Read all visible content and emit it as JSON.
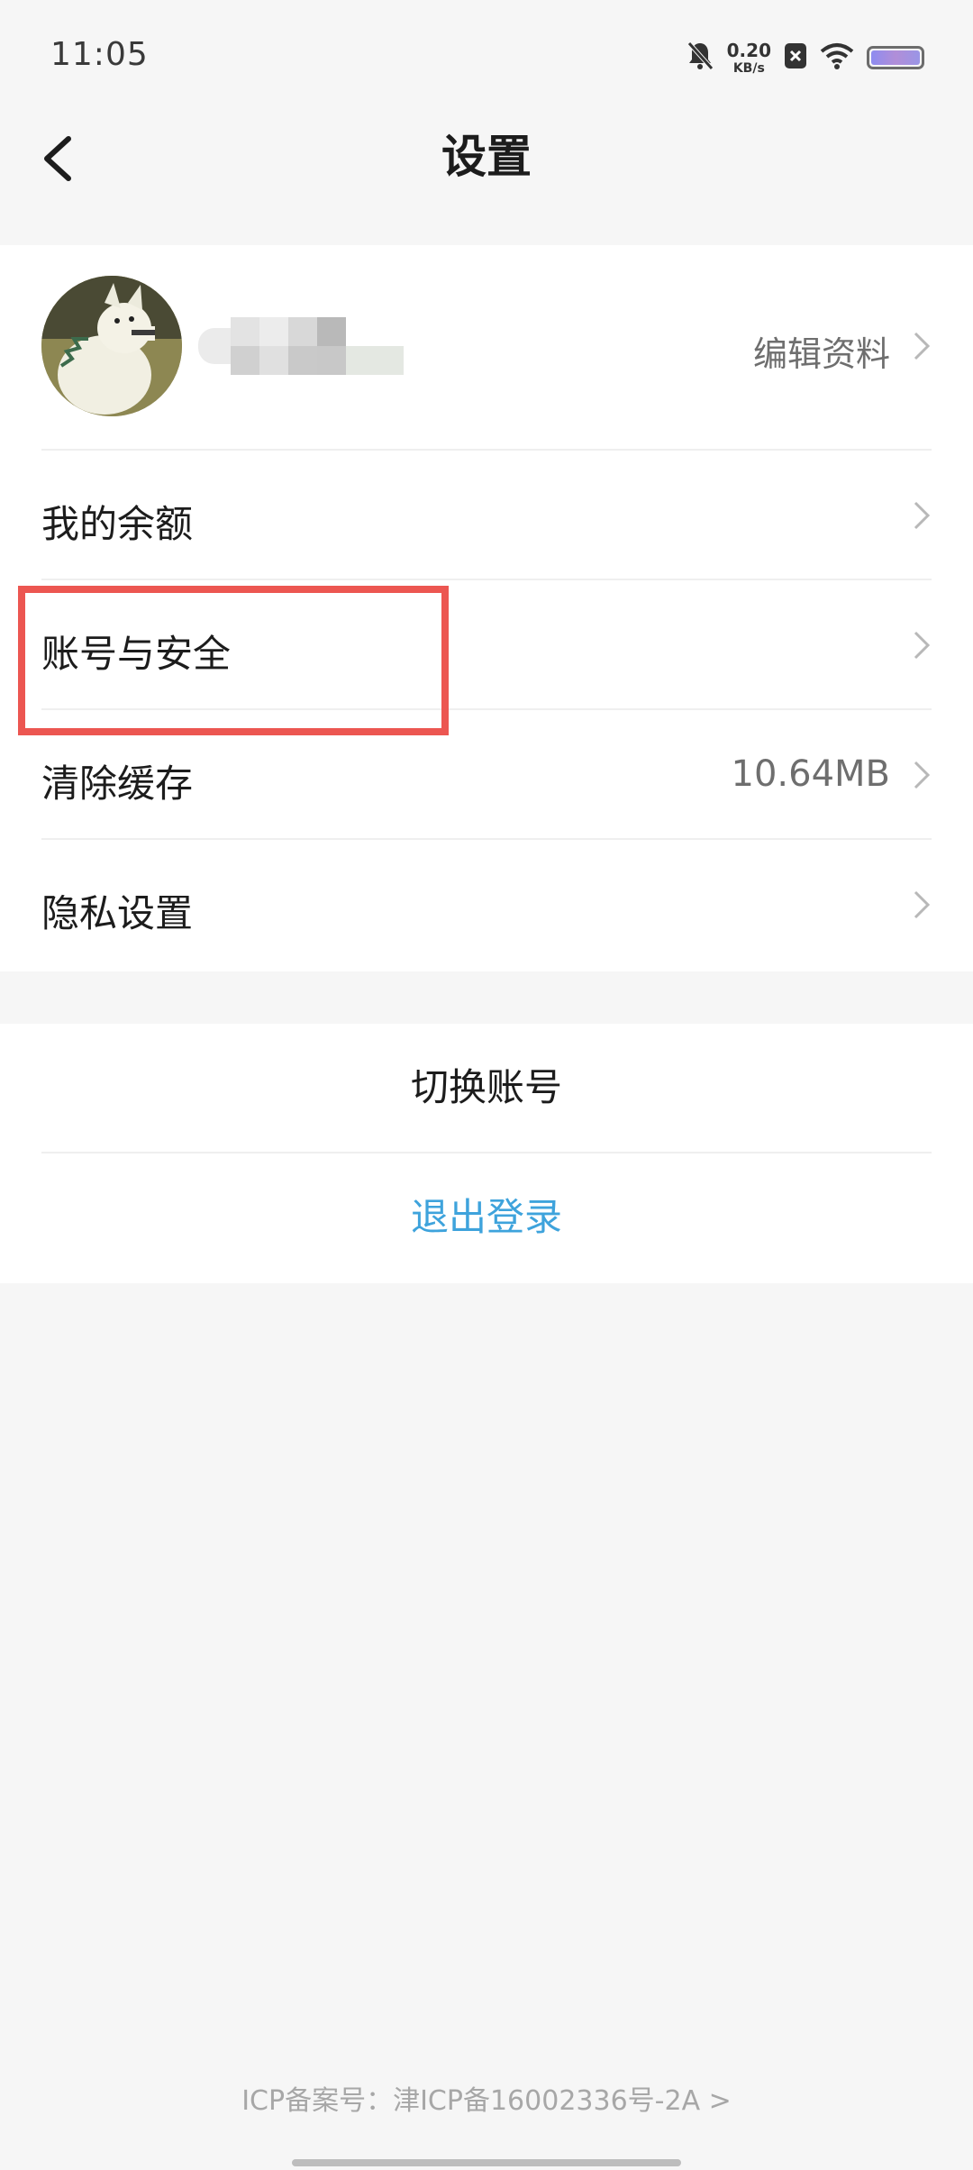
{
  "status_bar": {
    "time": "11:05",
    "net_speed_value": "0.20",
    "net_speed_unit": "KB/s",
    "icons": [
      "bell-muted-icon",
      "close-box-icon",
      "wifi-icon",
      "battery-icon"
    ]
  },
  "nav": {
    "back_icon": "chevron-left-icon",
    "title": "设置"
  },
  "profile": {
    "edit_label": "编辑资料",
    "avatar": "avatar-dog-photo"
  },
  "settings_items": [
    {
      "label": "我的余额",
      "value": ""
    },
    {
      "label": "账号与安全",
      "value": ""
    },
    {
      "label": "清除缓存",
      "value": "10.64MB"
    },
    {
      "label": "隐私设置",
      "value": ""
    }
  ],
  "account_actions": {
    "switch_account": "切换账号",
    "logout": "退出登录"
  },
  "footer": {
    "icp": "ICP备案号：津ICP备16002336号-2A >"
  },
  "colors": {
    "background": "#f6f6f6",
    "card": "#ffffff",
    "accent_blue": "#3ea3dc",
    "highlight_red": "#ec5651"
  }
}
